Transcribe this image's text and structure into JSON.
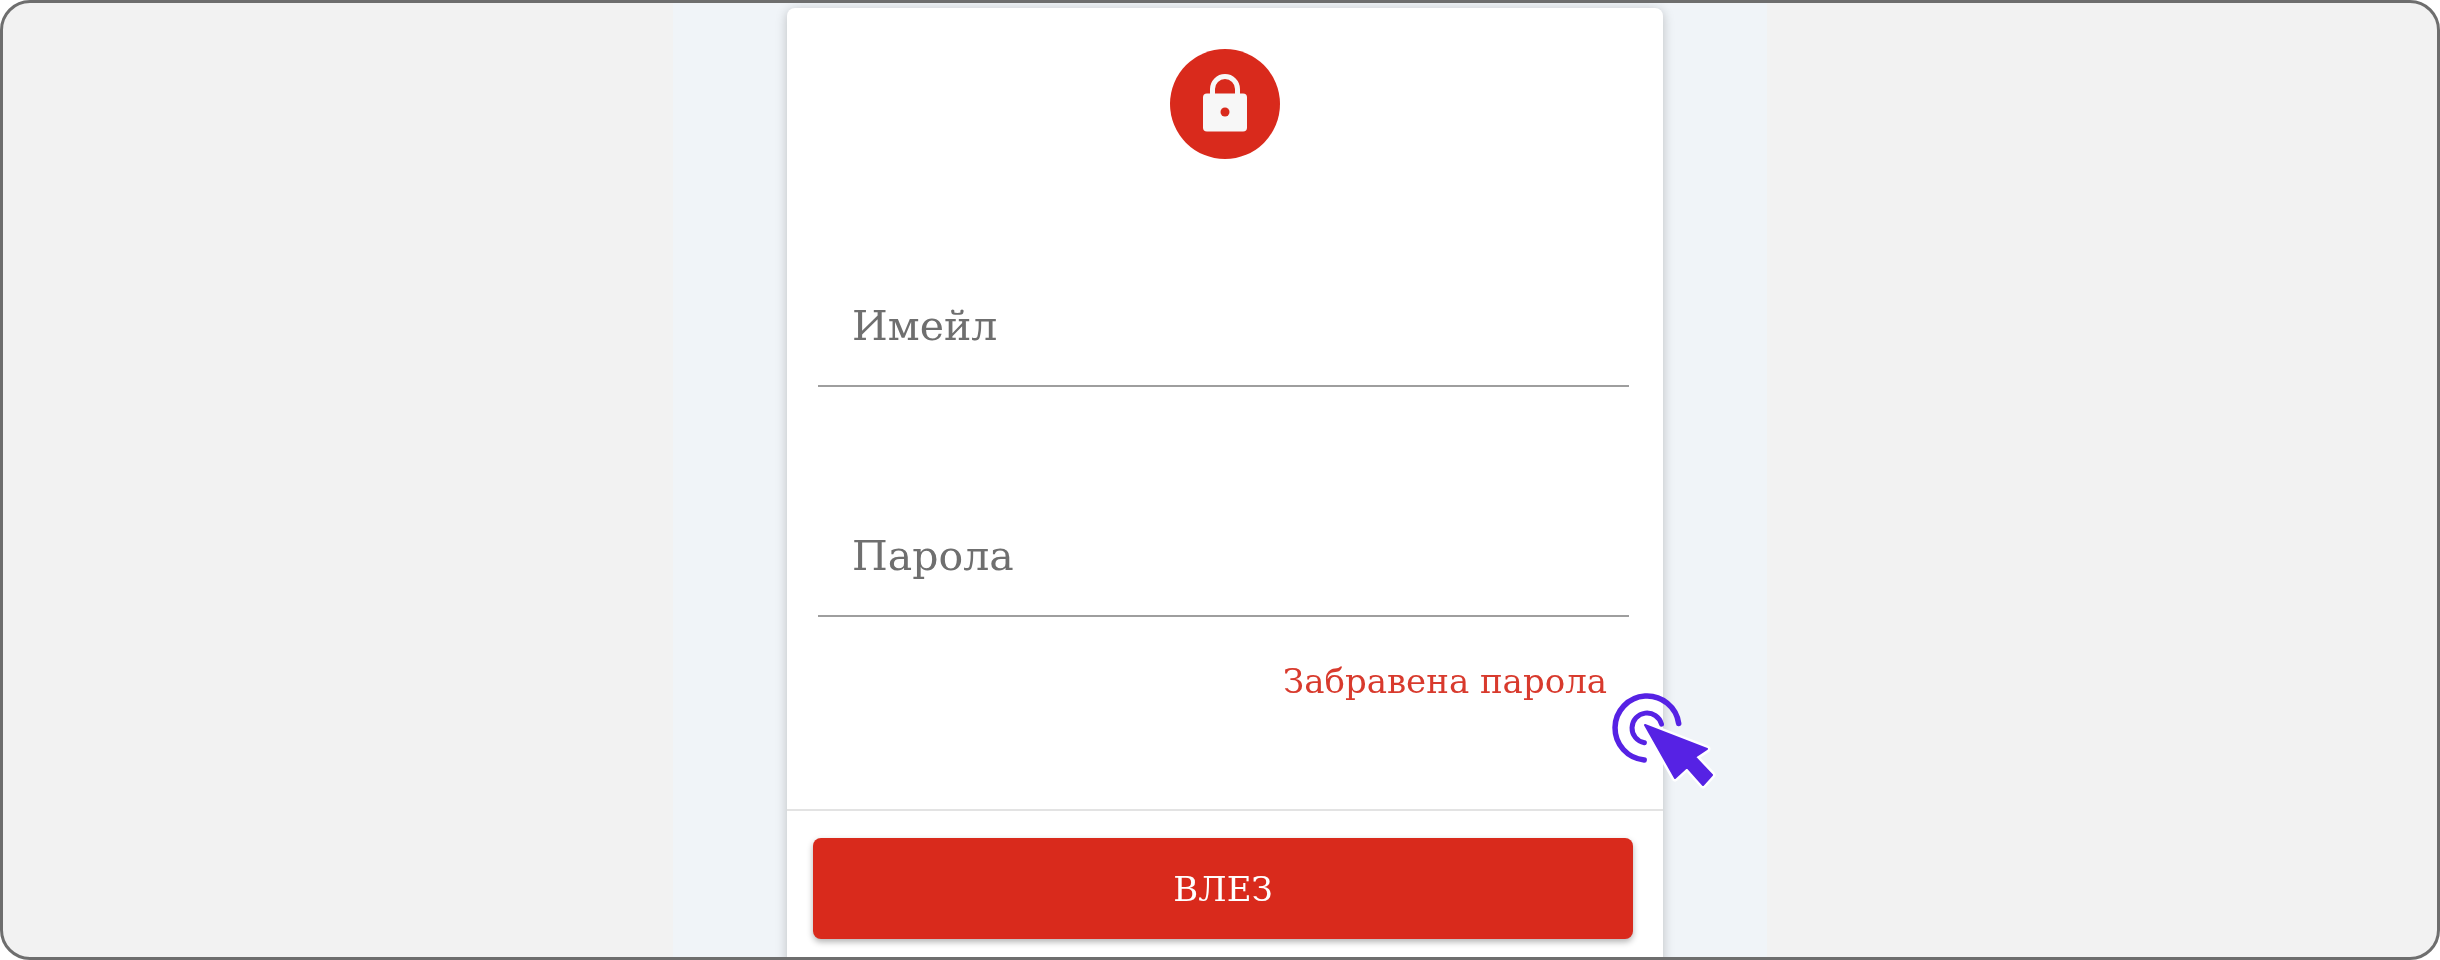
{
  "form": {
    "fields": [
      {
        "placeholder": "Имейл"
      },
      {
        "placeholder": "Парола"
      }
    ],
    "forgot_password_link": "Забравена парола",
    "submit_button": "ВЛЕЗ"
  }
}
